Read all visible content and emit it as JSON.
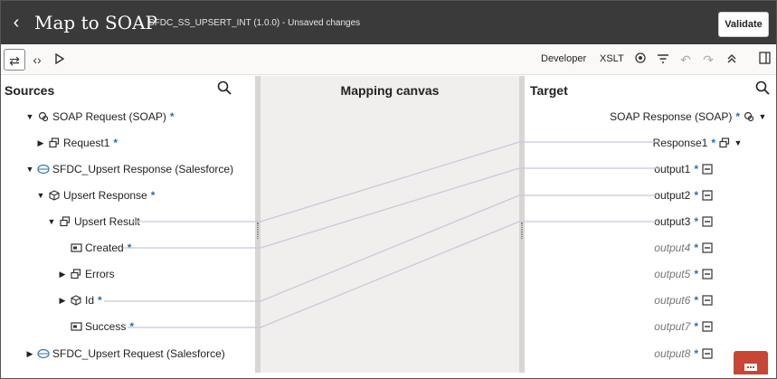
{
  "header": {
    "title": "Map to SOAP",
    "subtitle": "SFDC_SS_UPSERT_INT (1.0.0) - Unsaved changes",
    "validate_label": "Validate"
  },
  "toolbar": {
    "developer_label": "Developer",
    "xslt_label": "XSLT",
    "icons": [
      "swap-icon",
      "code-icon",
      "play-icon",
      "eye-icon",
      "filter-icon",
      "undo-icon",
      "redo-icon",
      "collapse-icon",
      "panel-toggle-icon"
    ]
  },
  "sources": {
    "title": "Sources",
    "items": [
      {
        "label": "SOAP Request (SOAP)",
        "required": "*",
        "caret": "down",
        "icon": "soap-icon"
      },
      {
        "label": "Request1",
        "required": "*",
        "caret": "right",
        "icon": "complex-type-icon"
      },
      {
        "label": "SFDC_Upsert Response (Salesforce)",
        "required": "",
        "caret": "down",
        "icon": "salesforce-icon"
      },
      {
        "label": "Upsert Response",
        "required": "*",
        "caret": "down",
        "icon": "cube-icon"
      },
      {
        "label": "Upsert Result",
        "required": "",
        "caret": "down",
        "icon": "complex-type-icon"
      },
      {
        "label": "Created",
        "required": "*",
        "caret": "",
        "icon": "field-icon"
      },
      {
        "label": "Errors",
        "required": "",
        "caret": "right",
        "icon": "complex-type-icon"
      },
      {
        "label": "Id",
        "required": "*",
        "caret": "right",
        "icon": "cube-icon"
      },
      {
        "label": "Success",
        "required": "*",
        "caret": "",
        "icon": "field-icon"
      },
      {
        "label": "SFDC_Upsert Request (Salesforce)",
        "required": "",
        "caret": "right",
        "icon": "salesforce-icon"
      }
    ]
  },
  "canvas": {
    "title": "Mapping canvas"
  },
  "target": {
    "title": "Target",
    "items": [
      {
        "label": "SOAP Response (SOAP)",
        "required": "*",
        "mapped": true
      },
      {
        "label": "Response1",
        "required": "*",
        "mapped": true
      },
      {
        "label": "output1",
        "required": "*",
        "mapped": true
      },
      {
        "label": "output2",
        "required": "*",
        "mapped": true
      },
      {
        "label": "output3",
        "required": "*",
        "mapped": true
      },
      {
        "label": "output4",
        "required": "*",
        "mapped": false
      },
      {
        "label": "output5",
        "required": "*",
        "mapped": false
      },
      {
        "label": "output6",
        "required": "*",
        "mapped": false
      },
      {
        "label": "output7",
        "required": "*",
        "mapped": false
      },
      {
        "label": "output8",
        "required": "*",
        "mapped": false
      }
    ]
  },
  "colors": {
    "header_bg": "#3a3a3a",
    "accent_star": "#2a6fa8",
    "map_line": "#c8c8dc",
    "chat_button": "#c74634"
  }
}
